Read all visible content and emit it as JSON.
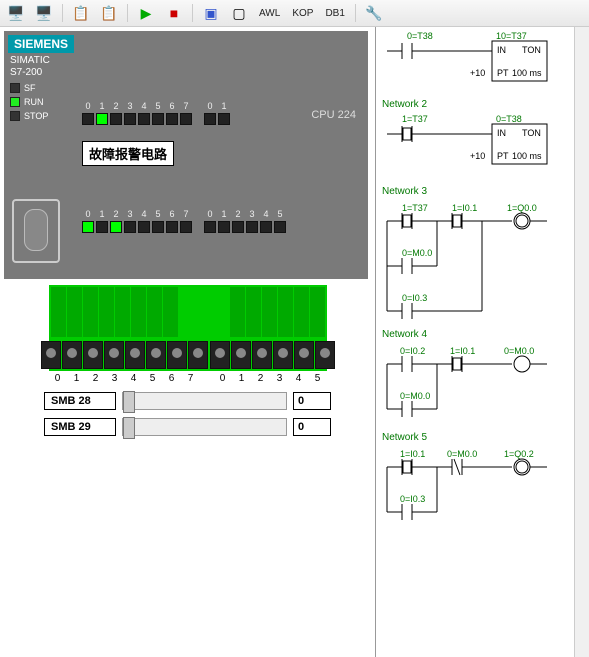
{
  "toolbar": {
    "text_buttons": [
      "AWL",
      "KOP",
      "DB1"
    ]
  },
  "plc": {
    "brand": "SIEMENS",
    "model_line1": "SIMATIC",
    "model_line2": "S7-200",
    "cpu": "CPU 224",
    "status_leds": [
      {
        "label": "SF",
        "color": ""
      },
      {
        "label": "RUN",
        "color": "green"
      },
      {
        "label": "STOP",
        "color": ""
      }
    ],
    "title_label": "故障报警电路",
    "top_io_labelsA": [
      "0",
      "1",
      "2",
      "3",
      "4",
      "5",
      "6",
      "7"
    ],
    "top_io_labelsB": [
      "0",
      "1"
    ],
    "bot_io_labelsA": [
      "0",
      "1",
      "2",
      "3",
      "4",
      "5",
      "6",
      "7"
    ],
    "bot_io_labelsB": [
      "0",
      "1",
      "2",
      "3",
      "4",
      "5"
    ]
  },
  "terminals": {
    "labelsA": [
      "0",
      "1",
      "2",
      "3",
      "4",
      "5",
      "6",
      "7"
    ],
    "labelsB": [
      "0",
      "1",
      "2",
      "3",
      "4",
      "5"
    ]
  },
  "sliders": [
    {
      "name": "SMB 28",
      "value": "0"
    },
    {
      "name": "SMB 29",
      "value": "0"
    }
  ],
  "networks": {
    "n1": {
      "c1_top": "0=T38",
      "c2_top": "10=T37",
      "box_in": "IN",
      "box_ton": "TON",
      "box_pt_left": "+10",
      "box_pt": "PT",
      "box_pt_right": "100 ms"
    },
    "n2": {
      "title": "Network 2",
      "c1_top": "1=T37",
      "c2_top": "0=T38",
      "box_in": "IN",
      "box_ton": "TON",
      "box_pt_left": "+10",
      "box_pt": "PT",
      "box_pt_right": "100 ms"
    },
    "n3": {
      "title": "Network 3",
      "c1": "1=T37",
      "c2": "1=I0.1",
      "coil": "1=Q0.0",
      "br1": "0=M0.0",
      "br2": "0=I0.3"
    },
    "n4": {
      "title": "Network 4",
      "c1": "0=I0.2",
      "c2": "1=I0.1",
      "coil": "0=M0.0",
      "br1": "0=M0.0"
    },
    "n5": {
      "title": "Network 5",
      "c1": "1=I0.1",
      "c2": "0=M0.0",
      "coil": "1=Q0.2",
      "br1": "0=I0.3"
    }
  }
}
